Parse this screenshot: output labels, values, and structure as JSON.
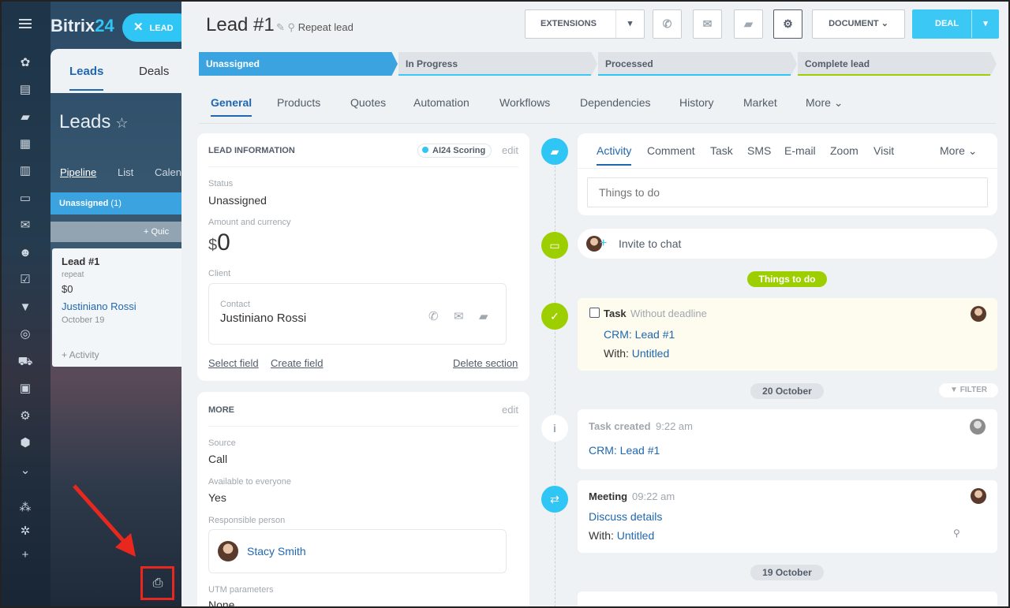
{
  "app": {
    "logo_main": "Bitrix",
    "logo_num": "24"
  },
  "lead_pill": {
    "label": "LEAD"
  },
  "back": {
    "tabs": [
      "Leads",
      "Deals"
    ],
    "title": "Leads",
    "views": [
      "Pipeline",
      "List",
      "Calen"
    ],
    "stage": {
      "name": "Unassigned",
      "count": "(1)"
    },
    "quick": "Quic",
    "card": {
      "title": "Lead #1",
      "subtitle": "repeat",
      "amount": "$0",
      "contact": "Justiniano Rossi",
      "date": "October 19",
      "activity": "+ Activity"
    }
  },
  "header": {
    "title": "Lead #1",
    "subtitle": "Repeat lead",
    "extensions_label": "EXTENSIONS",
    "document_label": "DOCUMENT",
    "deal_label": "DEAL"
  },
  "stages": [
    {
      "label": "Unassigned",
      "active": true,
      "bar": "#3ba4e0"
    },
    {
      "label": "In Progress",
      "active": false,
      "bar": "#3bc8f5"
    },
    {
      "label": "Processed",
      "active": false,
      "bar": "#2fc6f6"
    },
    {
      "label": "Complete lead",
      "active": false,
      "bar": "#9dcf00"
    }
  ],
  "tabs": [
    "General",
    "Products",
    "Quotes",
    "Automation",
    "Workflows",
    "Dependencies",
    "History",
    "Market",
    "More"
  ],
  "lead_info": {
    "title": "LEAD INFORMATION",
    "ai_badge": "AI24 Scoring",
    "edit": "edit",
    "status_label": "Status",
    "status_value": "Unassigned",
    "amount_label": "Amount and currency",
    "currency": "$",
    "amount": "0",
    "client_label": "Client",
    "contact_label": "Contact",
    "contact_name": "Justiniano Rossi",
    "select_field": "Select field",
    "create_field": "Create field",
    "delete_section": "Delete section"
  },
  "more_section": {
    "title": "MORE",
    "edit": "edit",
    "source_label": "Source",
    "source_value": "Call",
    "available_label": "Available to everyone",
    "available_value": "Yes",
    "responsible_label": "Responsible person",
    "responsible_name": "Stacy Smith",
    "utm_label": "UTM parameters",
    "utm_value": "None"
  },
  "timeline": {
    "tabs": [
      "Activity",
      "Comment",
      "Task",
      "SMS",
      "E-mail",
      "Zoom",
      "Visit",
      "More"
    ],
    "todo_placeholder": "Things to do",
    "invite": "Invite to chat",
    "things_to_do_pill": "Things to do",
    "task": {
      "title": "Task",
      "meta": "Without deadline",
      "link": "CRM: Lead #1",
      "with_label": "With:",
      "with_value": "Untitled"
    },
    "date1": "20 October",
    "filter": "FILTER",
    "created": {
      "title": "Task created",
      "time": "9:22 am",
      "link": "CRM: Lead #1"
    },
    "meeting": {
      "title": "Meeting",
      "time": "09:22 am",
      "link": "Discuss details",
      "with_label": "With:",
      "with_value": "Untitled"
    },
    "date2": "19 October"
  },
  "colors": {
    "accent": "#2fc6f6",
    "link": "#2067b0",
    "green": "#9dcf00",
    "highlight": "#e8281e"
  }
}
